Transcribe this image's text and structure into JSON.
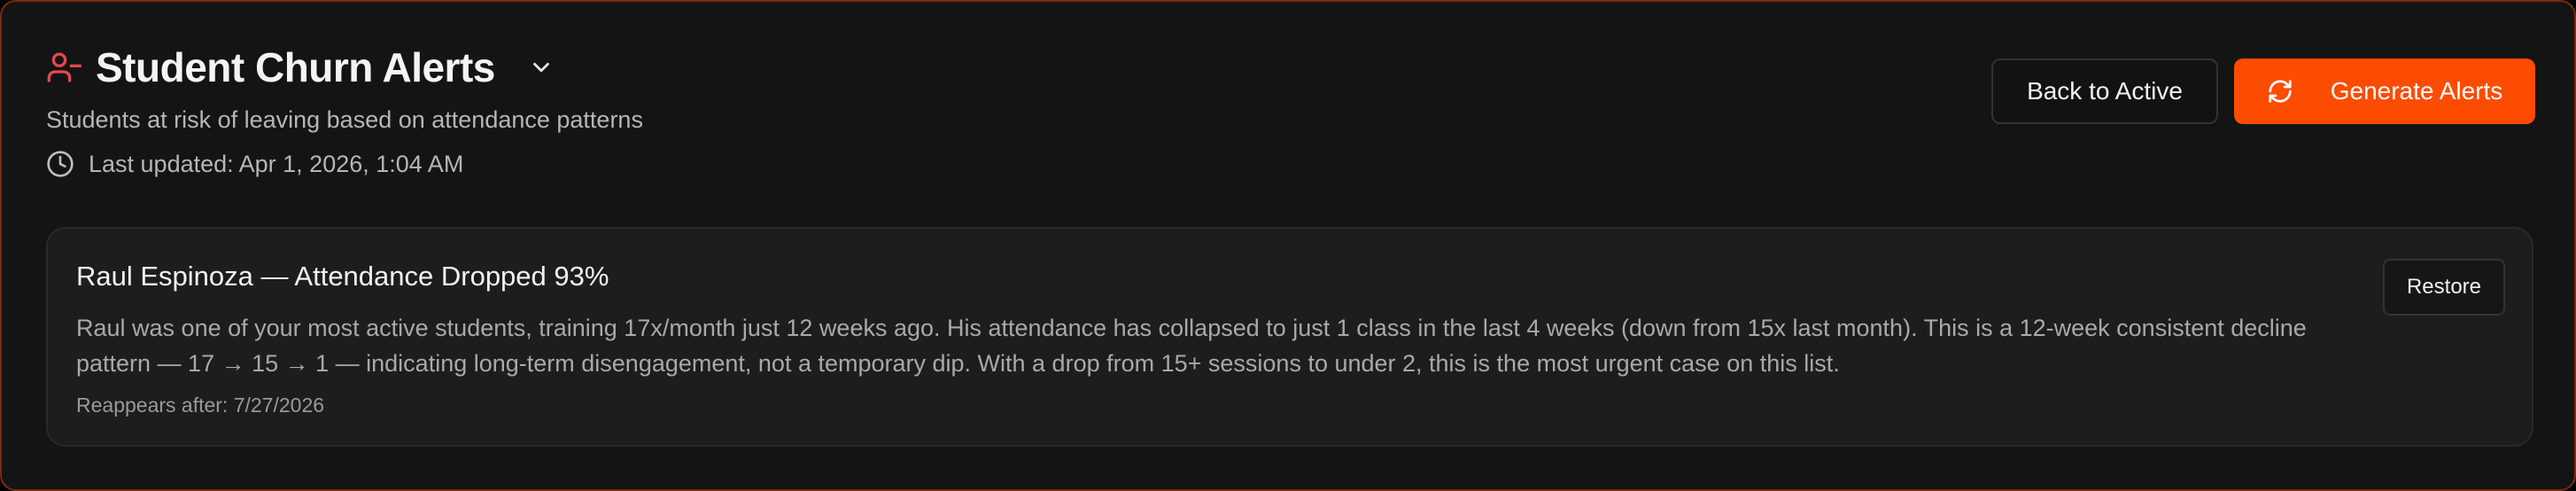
{
  "header": {
    "title": "Student Churn Alerts",
    "title_icon": "user-minus-icon",
    "dropdown_icon": "chevron-down-icon",
    "subtitle": "Students at risk of leaving based on attendance patterns",
    "last_updated": "Last updated: Apr 1, 2026, 1:04 AM",
    "clock_icon": "clock-icon"
  },
  "actions": {
    "back_label": "Back to Active",
    "generate_label": "Generate Alerts",
    "generate_icon": "refresh-icon"
  },
  "alerts": [
    {
      "title": "Raul Espinoza — Attendance Dropped 93%",
      "body": "Raul was one of your most active students, training 17x/month just 12 weeks ago. His attendance has collapsed to just 1 class in the last 4 weeks (down from 15x last month). This is a 12-week consistent decline pattern — 17 → 15 → 1 — indicating long-term disengagement, not a temporary dip. With a drop from 15+ sessions to under 2, this is the most urgent case on this list.",
      "reappears": "Reappears after: 7/27/2026",
      "restore_label": "Restore"
    }
  ],
  "colors": {
    "accent": "#fc4c02",
    "alert_icon": "#e5484d",
    "background": "#141414",
    "card": "#1d1d1d"
  }
}
